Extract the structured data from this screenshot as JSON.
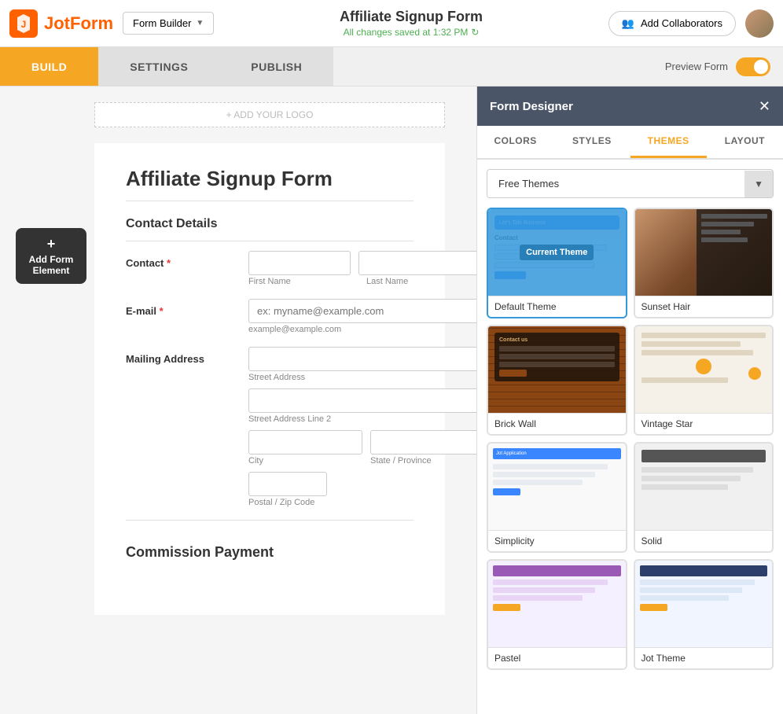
{
  "navbar": {
    "logo_text": "JotForm",
    "form_builder_label": "Form Builder",
    "form_title": "Affiliate Signup Form",
    "save_status": "All changes saved at 1:32 PM",
    "add_collaborators_label": "Add Collaborators",
    "preview_form_label": "Preview Form"
  },
  "subnav": {
    "tabs": [
      {
        "id": "build",
        "label": "BUILD",
        "active": true
      },
      {
        "id": "settings",
        "label": "SETTINGS",
        "active": false
      },
      {
        "id": "publish",
        "label": "PUBLISH",
        "active": false
      }
    ]
  },
  "form": {
    "add_logo_label": "+ ADD YOUR LOGO",
    "add_element_label": "Add Form Element",
    "title": "Affiliate Signup Form",
    "contact_section": "Contact Details",
    "fields": {
      "contact_label": "Contact",
      "contact_required": true,
      "first_name_placeholder": "",
      "last_name_placeholder": "",
      "first_name_sublabel": "First Name",
      "last_name_sublabel": "Last Name",
      "email_label": "E-mail",
      "email_required": true,
      "email_placeholder": "ex: myname@example.com",
      "email_sublabel": "example@example.com",
      "address_label": "Mailing Address",
      "street_label": "Street Address",
      "street2_label": "Street Address Line 2",
      "city_label": "City",
      "state_label": "State / Province",
      "zip_label": "Postal / Zip Code"
    },
    "commission_section": "Commission Payment"
  },
  "designer": {
    "title": "Form Designer",
    "tabs": [
      {
        "id": "colors",
        "label": "COLORS",
        "active": false
      },
      {
        "id": "styles",
        "label": "STYLES",
        "active": false
      },
      {
        "id": "themes",
        "label": "THEMES",
        "active": true
      },
      {
        "id": "layout",
        "label": "LAYOUT",
        "active": false
      }
    ],
    "filter_label": "Free Themes",
    "themes": [
      {
        "id": "default",
        "name": "Default Theme",
        "selected": true
      },
      {
        "id": "sunset-hair",
        "name": "Sunset Hair",
        "selected": false
      },
      {
        "id": "brick-wall",
        "name": "Brick Wall",
        "selected": false
      },
      {
        "id": "vintage-star",
        "name": "Vintage Star",
        "selected": false
      },
      {
        "id": "simplicity",
        "name": "Simplicity",
        "selected": false
      },
      {
        "id": "solid",
        "name": "Solid",
        "selected": false
      },
      {
        "id": "pastel",
        "name": "Pastel",
        "selected": false
      },
      {
        "id": "jot-theme",
        "name": "Jot Theme",
        "selected": false
      }
    ]
  }
}
